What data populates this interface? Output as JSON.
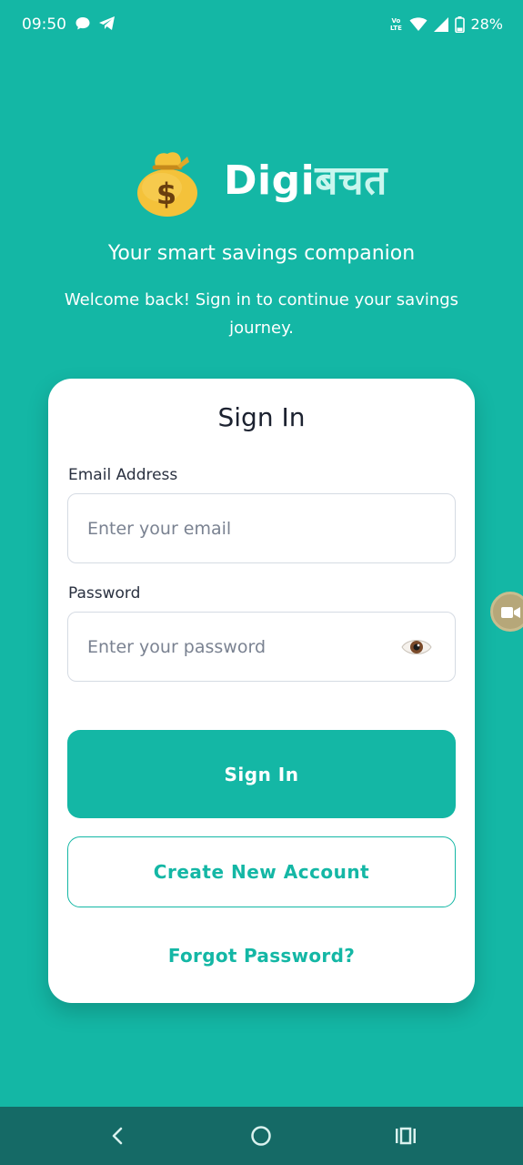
{
  "status_bar": {
    "time": "09:50",
    "volte_top": "Vo",
    "volte_bottom": "LTE",
    "battery": "28%"
  },
  "brand": {
    "name_latin": "Digi",
    "name_devanagari": "बचत",
    "tagline": "Your smart savings companion",
    "welcome": "Welcome back! Sign in to continue your savings journey."
  },
  "signin_card": {
    "title": "Sign In",
    "email": {
      "label": "Email Address",
      "placeholder": "Enter your email",
      "value": ""
    },
    "password": {
      "label": "Password",
      "placeholder": "Enter your password",
      "value": ""
    },
    "signin_button": "Sign In",
    "create_account_button": "Create New Account",
    "forgot_password": "Forgot Password?"
  },
  "colors": {
    "background": "#14b7a5",
    "accent": "#14b7a5",
    "card": "#ffffff",
    "nav_bar": "#156a66"
  },
  "icons": {
    "money_bag": "money-bag-icon",
    "eye": "eye-icon",
    "nav_back": "back-icon",
    "nav_home": "home-icon",
    "nav_recents": "recents-icon"
  }
}
